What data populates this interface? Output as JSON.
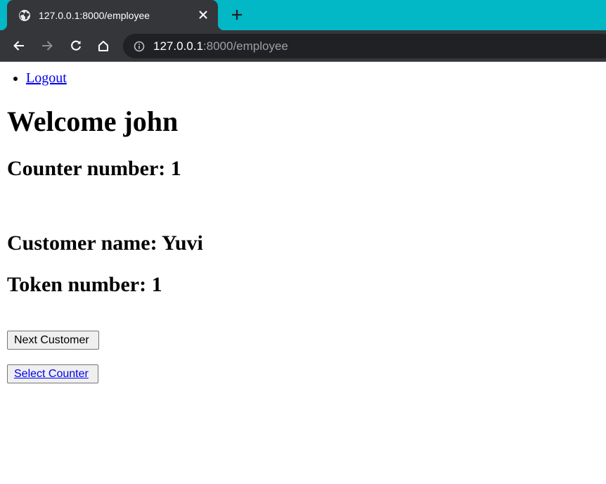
{
  "browser": {
    "tab": {
      "title": "127.0.0.1:8000/employee",
      "favicon": "globe-icon"
    },
    "colors": {
      "tabbar_bg": "#02b7c6",
      "chrome_bg": "#35363a",
      "omnibox_bg": "#202124"
    },
    "toolbar": {
      "back": "back-arrow-icon",
      "forward": "forward-arrow-icon",
      "reload": "reload-icon",
      "home": "home-icon"
    },
    "address_bar": {
      "host": "127.0.0.1",
      "rest": ":8000/employee"
    }
  },
  "page": {
    "nav": {
      "items": [
        {
          "label": "Logout"
        }
      ]
    },
    "title": "Welcome john",
    "counter_number": "Counter number: 1",
    "customer_name": "Customer name: Yuvi",
    "token_number": "Token number: 1",
    "buttons": {
      "next_customer": "Next Customer",
      "select_counter": "Select Counter"
    }
  }
}
